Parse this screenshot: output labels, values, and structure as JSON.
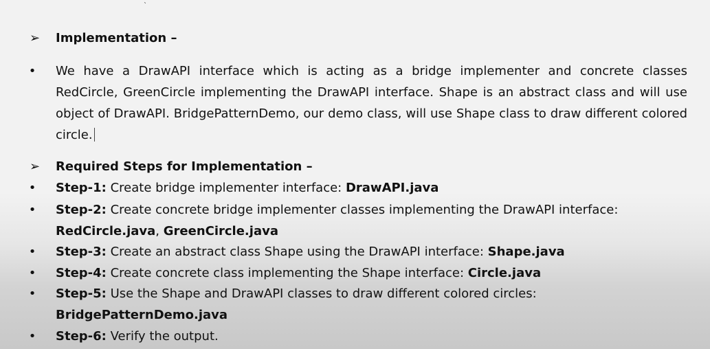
{
  "speck": "`",
  "bullet_glyph": "•",
  "arrow_glyph": "➢",
  "section1": {
    "heading": "Implementation –",
    "paragraph": "We have a DrawAPI interface which is acting as a bridge implementer and concrete classes RedCircle, GreenCircle implementing the DrawAPI interface. Shape is an abstract class and will use object of DrawAPI. BridgePatternDemo, our demo class, will use Shape class to draw different colored circle."
  },
  "section2": {
    "heading": "Required Steps for Implementation –",
    "steps": [
      {
        "label": "Step-1:",
        "text": " Create bridge implementer interface: ",
        "file": "DrawAPI.java"
      },
      {
        "label": "Step-2:",
        "text": " Create concrete bridge implementer classes implementing the DrawAPI interface:",
        "file": "RedCircle.java",
        "sep": ", ",
        "file2": "GreenCircle.java"
      },
      {
        "label": "Step-3:",
        "text": " Create an abstract class Shape using the DrawAPI interface: ",
        "file": "Shape.java"
      },
      {
        "label": "Step-4:",
        "text": " Create concrete class implementing the Shape interface: ",
        "file": "Circle.java"
      },
      {
        "label": "Step-5:",
        "text": " Use the Shape and DrawAPI classes to draw different colored circles:",
        "file": "BridgePatternDemo.java"
      },
      {
        "label": "Step-6:",
        "text": " Verify the output."
      }
    ]
  }
}
